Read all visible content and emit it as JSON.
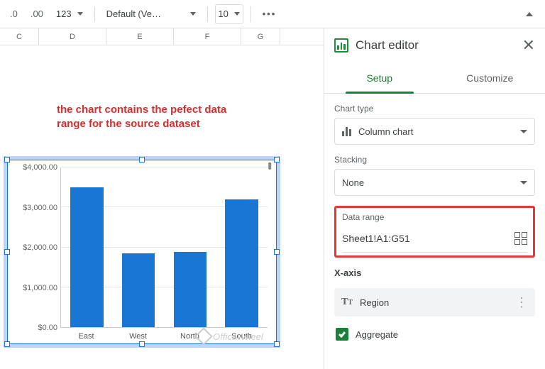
{
  "toolbar": {
    "dec_decimal": ".0",
    "inc_decimal": ".00",
    "format_menu": "123",
    "font": "Default (Ve…",
    "font_size": "10",
    "more": "•••"
  },
  "columns": {
    "c": "C",
    "d": "D",
    "e": "E",
    "f": "F",
    "g": "G"
  },
  "annotation": "the chart contains the pefect data range for the source dataset",
  "watermark": "OfficeWheel",
  "editor": {
    "title": "Chart editor",
    "tabs": {
      "setup": "Setup",
      "customize": "Customize"
    },
    "chart_type_label": "Chart type",
    "chart_type_value": "Column chart",
    "stacking_label": "Stacking",
    "stacking_value": "None",
    "data_range_label": "Data range",
    "data_range_value": "Sheet1!A1:G51",
    "xaxis_label": "X-axis",
    "xaxis_value": "Region",
    "aggregate_label": "Aggregate"
  },
  "chart_data": {
    "type": "bar",
    "categories": [
      "East",
      "West",
      "North",
      "South"
    ],
    "values": [
      3500,
      1850,
      1880,
      3200
    ],
    "ylim": [
      0,
      4000
    ],
    "yticks": [
      "$0.00",
      "$1,000.00",
      "$2,000.00",
      "$3,000.00",
      "$4,000.00"
    ],
    "title": "",
    "xlabel": "",
    "ylabel": ""
  }
}
